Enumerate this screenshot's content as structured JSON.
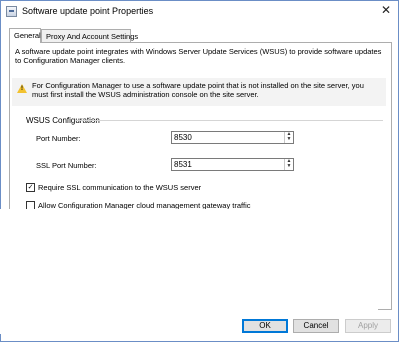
{
  "window": {
    "title": "Software update point Properties",
    "close_glyph": "✕",
    "icon": "properties-window-icon"
  },
  "tabs": [
    {
      "label": "General",
      "active": true
    },
    {
      "label": "Proxy And Account Settings",
      "active": false
    }
  ],
  "general": {
    "intro": "A software update point integrates with Windows Server Update Services (WSUS) to provide software updates to Configuration Manager clients.",
    "info": {
      "icon": "warning-icon",
      "text": "For Configuration Manager to use a software update point that is not installed on the site server, you must first install the WSUS administration console on the site server."
    },
    "wsus_config": {
      "group_label": "WSUS Configuration",
      "port_label": "Port Number:",
      "port_value": "8530",
      "ssl_port_label": "SSL Port Number:",
      "ssl_port_value": "8531"
    },
    "require_ssl": {
      "label": "Require SSL communication to the WSUS server",
      "checked": true,
      "check_glyph": "✓"
    },
    "cmg_traffic": {
      "label": "Allow Configuration Manager cloud management gateway traffic",
      "checked": false
    }
  },
  "buttons": {
    "ok": "OK",
    "cancel": "Cancel",
    "apply": "Apply"
  },
  "spin_glyphs": {
    "up": "▲",
    "down": "▼"
  },
  "colors": {
    "accent": "#0078d7",
    "warning": "#f2c230",
    "window_border": "#6b8ec6"
  }
}
